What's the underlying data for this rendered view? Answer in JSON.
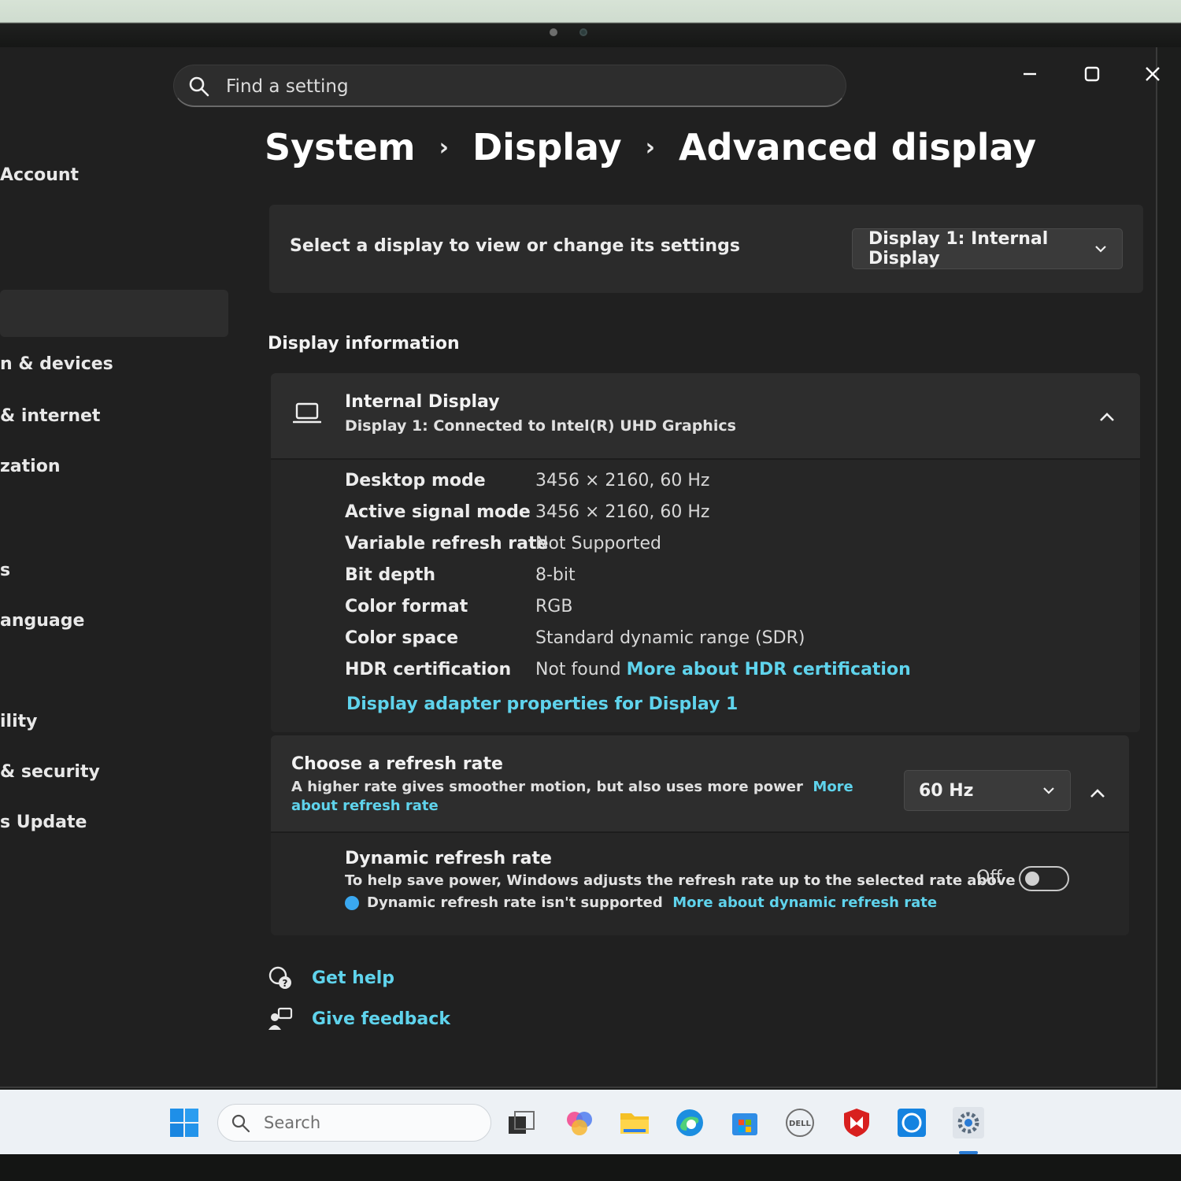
{
  "search": {
    "placeholder": "Find a setting"
  },
  "sidebar": {
    "items": [
      {
        "label": "Account"
      },
      {
        "label": "n & devices"
      },
      {
        "label": "& internet"
      },
      {
        "label": "zation"
      },
      {
        "label": "s"
      },
      {
        "label": "anguage"
      },
      {
        "label": "ility"
      },
      {
        "label": "& security"
      },
      {
        "label": "s Update"
      }
    ]
  },
  "breadcrumb": {
    "level1": "System",
    "level2": "Display",
    "level3": "Advanced display"
  },
  "select_display": {
    "label": "Select a display to view or change its settings",
    "selected": "Display 1: Internal Display"
  },
  "display_info": {
    "heading": "Display information",
    "title": "Internal Display",
    "subtitle": "Display 1: Connected to Intel(R) UHD Graphics",
    "properties": [
      {
        "label": "Desktop mode",
        "value": "3456 × 2160, 60 Hz"
      },
      {
        "label": "Active signal mode",
        "value": "3456 × 2160, 60 Hz"
      },
      {
        "label": "Variable refresh rate",
        "value": "Not Supported"
      },
      {
        "label": "Bit depth",
        "value": "8-bit"
      },
      {
        "label": "Color format",
        "value": "RGB"
      },
      {
        "label": "Color space",
        "value": "Standard dynamic range (SDR)"
      },
      {
        "label": "HDR certification",
        "value": "Not found",
        "link": "More about HDR certification"
      }
    ],
    "adapter_link": "Display adapter properties for Display 1"
  },
  "refresh_rate": {
    "title": "Choose a refresh rate",
    "description": "A higher rate gives smoother motion, but also uses more power",
    "link": "More about refresh rate",
    "selected": "60 Hz",
    "dynamic": {
      "title": "Dynamic refresh rate",
      "description": "To help save power, Windows adjusts the refresh rate up to the selected rate above",
      "note": "Dynamic refresh rate isn't supported",
      "note_link": "More about dynamic refresh rate",
      "state_label": "Off"
    }
  },
  "help": {
    "get_help": "Get help",
    "give_feedback": "Give feedback"
  },
  "taskbar": {
    "search_placeholder": "Search"
  },
  "colors": {
    "accent_link": "#5fd3ec",
    "background": "#202020",
    "card": "#2b2b2b"
  }
}
